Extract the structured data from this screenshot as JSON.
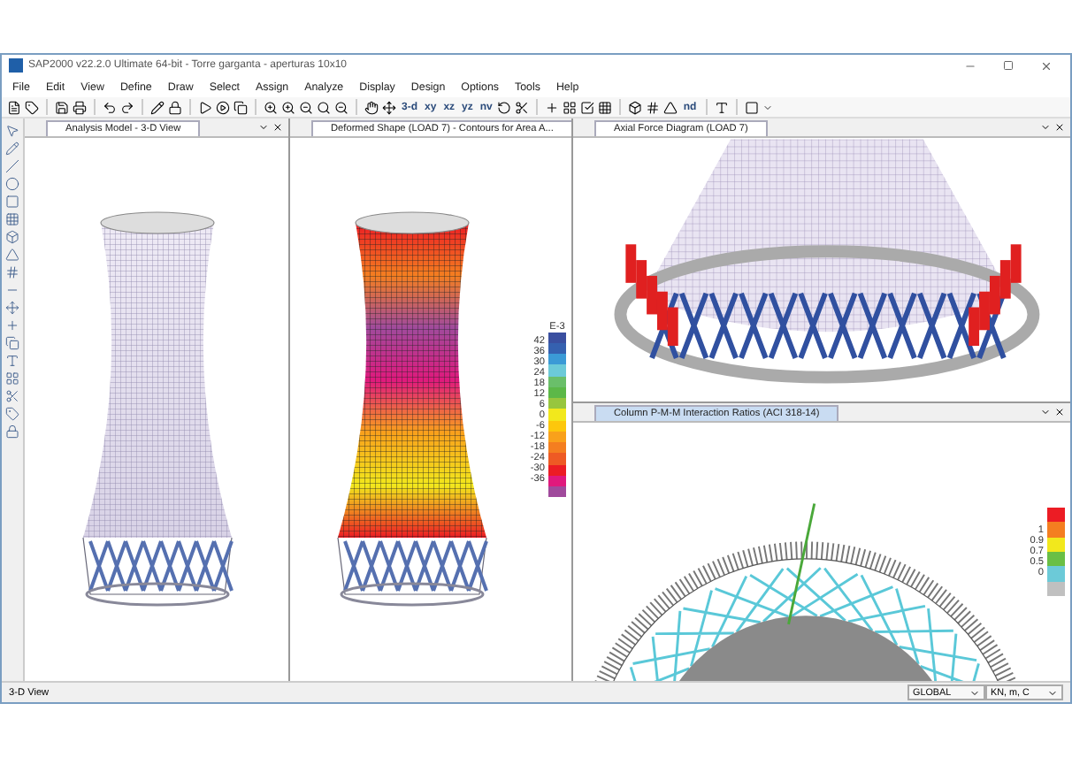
{
  "window": {
    "title": "SAP2000 v22.2.0 Ultimate 64-bit - Torre garganta - aperturas 10x10"
  },
  "menu": [
    "File",
    "Edit",
    "View",
    "Define",
    "Draw",
    "Select",
    "Assign",
    "Analyze",
    "Display",
    "Design",
    "Options",
    "Tools",
    "Help"
  ],
  "toolbar": {
    "view_buttons": [
      "3-d",
      "xy",
      "xz",
      "yz",
      "nv"
    ],
    "nd_button": "nd"
  },
  "panels": [
    {
      "kind": "model",
      "title": "Analysis Model - 3-D View",
      "selected": false
    },
    {
      "kind": "contour",
      "title": "Deformed Shape (LOAD 7) - Contours for Area A...",
      "selected": false,
      "legend": {
        "unit": "E-3",
        "labels": [
          "42",
          "36",
          "30",
          "24",
          "18",
          "12",
          "6",
          "0",
          "-6",
          "-12",
          "-18",
          "-24",
          "-30",
          "-36"
        ],
        "swatches": [
          {
            "color": "#3a4fa0"
          },
          {
            "color": "#3561b0"
          },
          {
            "color": "#3b9ad6"
          },
          {
            "color": "#6ccad8"
          },
          {
            "color": "#6abf6a"
          },
          {
            "color": "#5cb848"
          },
          {
            "color": "#97c63e"
          },
          {
            "color": "#f2e81c"
          },
          {
            "color": "#fdc70c"
          },
          {
            "color": "#f9a11b"
          },
          {
            "color": "#f47e20"
          },
          {
            "color": "#ee5a24"
          },
          {
            "color": "#ec1c24"
          },
          {
            "color": "#e0197d"
          },
          {
            "color": "#a04a9c"
          }
        ]
      }
    },
    {
      "kind": "axial",
      "title": "Axial Force Diagram (LOAD 7)",
      "selected": false
    },
    {
      "kind": "ratio",
      "title": "Column P-M-M Interaction Ratios  (ACI 318-14)",
      "selected": true,
      "legend": {
        "labels": [
          "1",
          "0.9",
          "0.7",
          "0.5",
          "0"
        ],
        "swatches": [
          {
            "color": "#ec1c24"
          },
          {
            "color": "#f47e20"
          },
          {
            "color": "#f2e81c"
          },
          {
            "color": "#6abf45"
          },
          {
            "color": "#6ccad8"
          },
          {
            "color": "#c0c0c0"
          }
        ]
      }
    }
  ],
  "status_bar": {
    "view": "3-D View",
    "coord_system": "GLOBAL",
    "units": "KN, m, C"
  }
}
